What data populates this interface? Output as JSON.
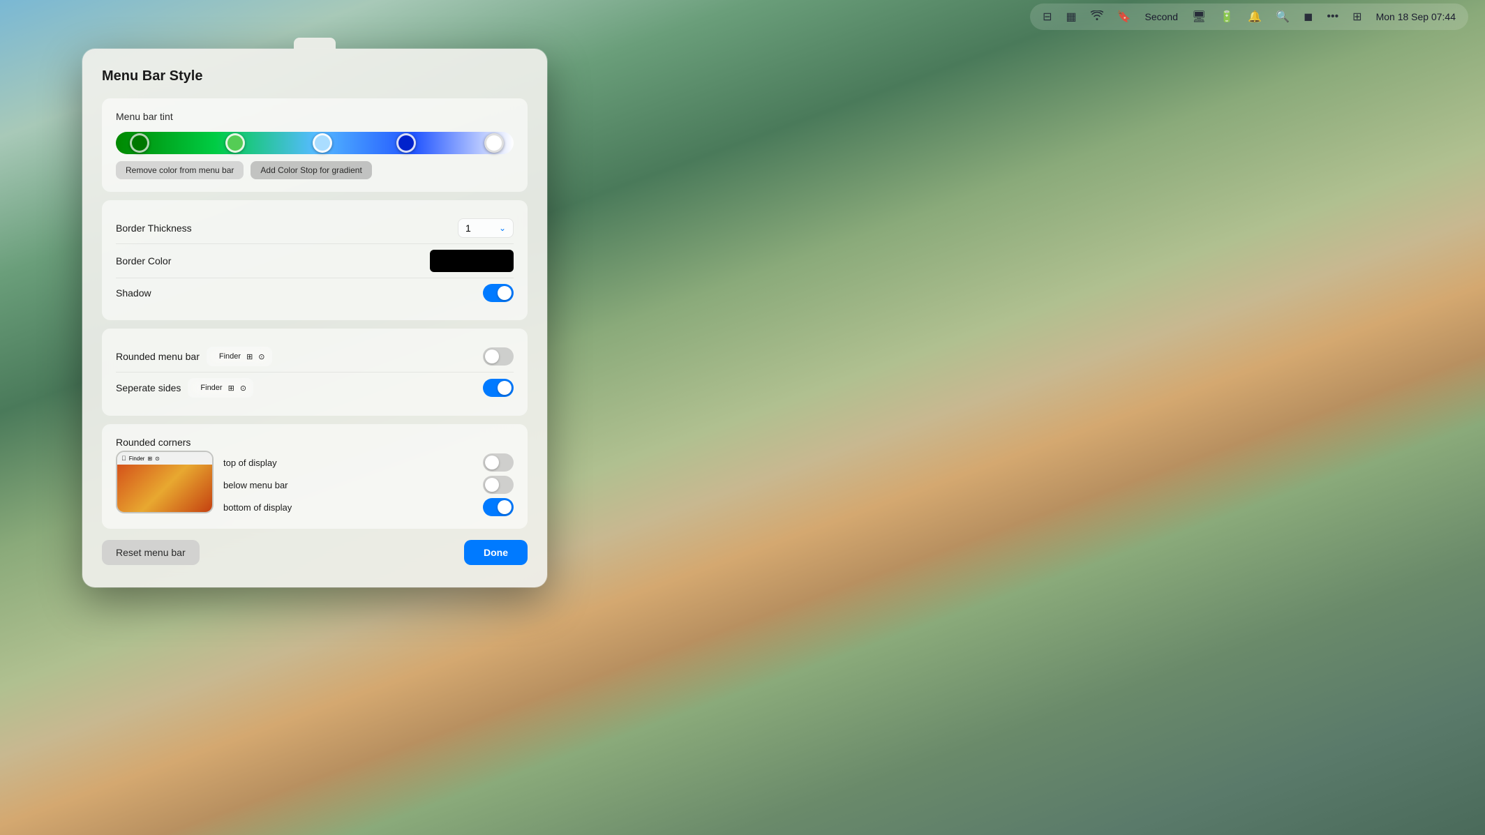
{
  "menubar": {
    "datetime": "Mon 18 Sep  07:44",
    "second_label": "Second",
    "icons": [
      "⊟",
      "▦",
      "wifi",
      "🔖",
      "🖥",
      "🔋",
      "🔔",
      "🔍",
      "◼",
      "•••",
      "⊞"
    ]
  },
  "dialog": {
    "title": "Menu Bar Style",
    "sections": {
      "menu_bar_tint": {
        "label": "Menu bar tint",
        "remove_btn": "Remove color from menu bar",
        "add_btn": "Add Color Stop for gradient",
        "color_stops": [
          {
            "left": "6%",
            "bg": "#008800"
          },
          {
            "left": "30%",
            "bg": "#55cc55"
          },
          {
            "left": "52%",
            "bg": "#aaddff"
          },
          {
            "left": "74%",
            "bg": "#0000cc"
          },
          {
            "left": "95%",
            "bg": "#ffffff"
          }
        ]
      },
      "border": {
        "thickness_label": "Border Thickness",
        "thickness_value": "1",
        "color_label": "Border Color",
        "shadow_label": "Shadow",
        "shadow_on": true
      },
      "rounded_menu": {
        "rounded_label": "Rounded menu bar",
        "rounded_on": false,
        "separate_label": "Seperate sides",
        "separate_on": true,
        "preview_items": [
          "",
          "Finder",
          "⊞",
          "⊙"
        ]
      },
      "rounded_corners": {
        "label": "Rounded corners",
        "top_label": "top of display",
        "top_on": false,
        "below_label": "below menu bar",
        "below_on": false,
        "bottom_label": "bottom of display",
        "bottom_on": true
      }
    },
    "footer": {
      "reset_label": "Reset menu bar",
      "done_label": "Done"
    }
  }
}
